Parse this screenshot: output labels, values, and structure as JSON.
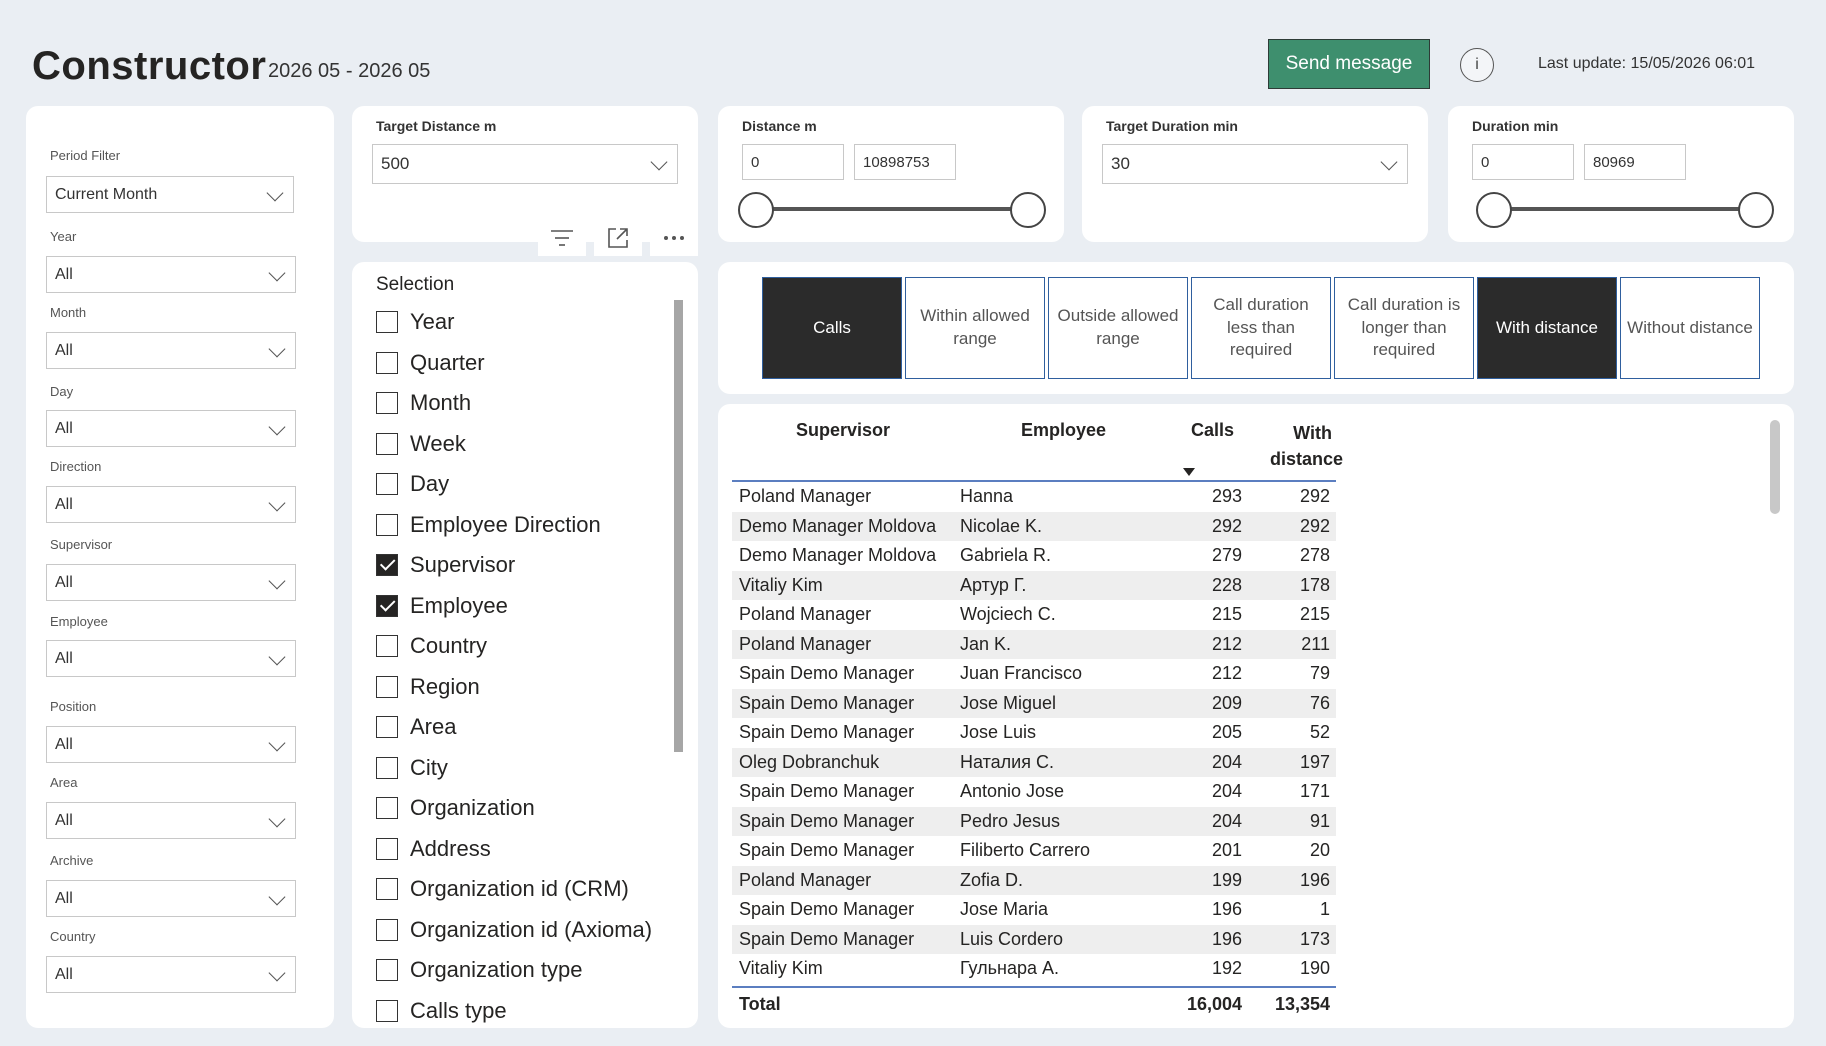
{
  "header": {
    "title": "Constructor",
    "period": "2026 05 - 2026 05",
    "send_button": "Send message",
    "info_icon": "i",
    "last_update": "Last update: 15/05/2026 06:01"
  },
  "filters": [
    {
      "label": "Period Filter",
      "value": "Current Month"
    },
    {
      "label": "Year",
      "value": "All"
    },
    {
      "label": "Month",
      "value": "All"
    },
    {
      "label": "Day",
      "value": "All"
    },
    {
      "label": "Direction",
      "value": "All"
    },
    {
      "label": "Supervisor",
      "value": "All"
    },
    {
      "label": "Employee",
      "value": "All"
    },
    {
      "label": "Position",
      "value": "All"
    },
    {
      "label": "Area",
      "value": "All"
    },
    {
      "label": "Archive",
      "value": "All"
    },
    {
      "label": "Country",
      "value": "All"
    }
  ],
  "slicers": {
    "target_distance": {
      "label": "Target Distance m",
      "value": "500"
    },
    "distance": {
      "label": "Distance m",
      "min": "0",
      "max": "10898753"
    },
    "target_duration": {
      "label": "Target Duration min",
      "value": "30"
    },
    "duration": {
      "label": "Duration min",
      "min": "0",
      "max": "80969"
    }
  },
  "toolbar_icons": [
    "filter-icon",
    "focus-mode-icon",
    "more-options-icon"
  ],
  "selection": {
    "title": "Selection",
    "items": [
      {
        "label": "Year",
        "checked": false
      },
      {
        "label": "Quarter",
        "checked": false
      },
      {
        "label": "Month",
        "checked": false
      },
      {
        "label": "Week",
        "checked": false
      },
      {
        "label": "Day",
        "checked": false
      },
      {
        "label": "Employee Direction",
        "checked": false
      },
      {
        "label": "Supervisor",
        "checked": true
      },
      {
        "label": "Employee",
        "checked": true
      },
      {
        "label": "Country",
        "checked": false
      },
      {
        "label": "Region",
        "checked": false
      },
      {
        "label": "Area",
        "checked": false
      },
      {
        "label": "City",
        "checked": false
      },
      {
        "label": "Organization",
        "checked": false
      },
      {
        "label": "Address",
        "checked": false
      },
      {
        "label": "Organization id (CRM)",
        "checked": false
      },
      {
        "label": "Organization id (Axioma)",
        "checked": false
      },
      {
        "label": "Organization type",
        "checked": false
      },
      {
        "label": "Calls type",
        "checked": false
      }
    ]
  },
  "toggles": [
    {
      "label": "Calls",
      "active": true
    },
    {
      "label": "Within allowed range",
      "active": false
    },
    {
      "label": "Outside allowed range",
      "active": false
    },
    {
      "label": "Call duration less than required",
      "active": false
    },
    {
      "label": "Call duration is longer than required",
      "active": false
    },
    {
      "label": "With distance",
      "active": true
    },
    {
      "label": "Without distance",
      "active": false
    }
  ],
  "table": {
    "columns": {
      "supervisor": "Supervisor",
      "employee": "Employee",
      "calls": "Calls",
      "with_distance_1": "With",
      "with_distance_2": "distance"
    },
    "rows": [
      [
        "Poland Manager",
        "Hanna",
        "293",
        "292"
      ],
      [
        "Demo Manager Moldova",
        "Nicolae K.",
        "292",
        "292"
      ],
      [
        "Demo Manager Moldova",
        "Gabriela R.",
        "279",
        "278"
      ],
      [
        "Vitaliy Kim",
        "Артур Г.",
        "228",
        "178"
      ],
      [
        "Poland Manager",
        "Wojciech C.",
        "215",
        "215"
      ],
      [
        "Poland Manager",
        "Jan K.",
        "212",
        "211"
      ],
      [
        "Spain Demo Manager",
        "Juan Francisco",
        "212",
        "79"
      ],
      [
        "Spain Demo Manager",
        "Jose Miguel",
        "209",
        "76"
      ],
      [
        "Spain Demo Manager",
        "Jose Luis",
        "205",
        "52"
      ],
      [
        "Oleg Dobranchuk",
        "Наталия С.",
        "204",
        "197"
      ],
      [
        "Spain Demo Manager",
        "Antonio Jose",
        "204",
        "171"
      ],
      [
        "Spain Demo Manager",
        "Pedro Jesus",
        "204",
        "91"
      ],
      [
        "Spain Demo Manager",
        "Filiberto Carrero",
        "201",
        "20"
      ],
      [
        "Poland Manager",
        "Zofia D.",
        "199",
        "196"
      ],
      [
        "Spain Demo Manager",
        "Jose Maria",
        "196",
        "1"
      ],
      [
        "Spain Demo Manager",
        "Luis Cordero",
        "196",
        "173"
      ],
      [
        "Vitaliy Kim",
        "Гульнара А.",
        "192",
        "190"
      ]
    ],
    "total": {
      "label": "Total",
      "calls": "16,004",
      "with_distance": "13,354"
    }
  }
}
